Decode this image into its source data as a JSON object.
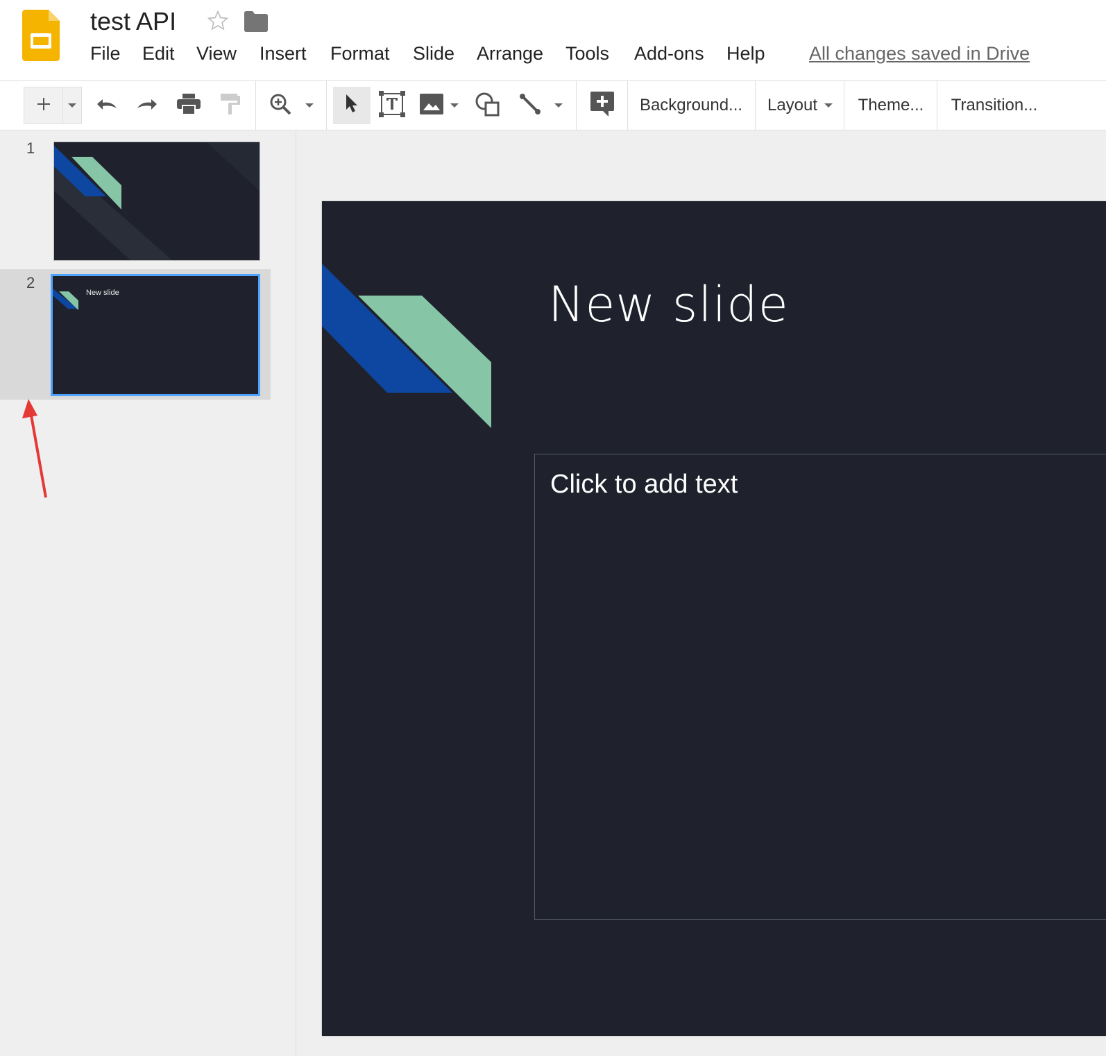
{
  "app": {
    "title": "test API",
    "save_status": "All changes saved in Drive"
  },
  "menu": [
    "File",
    "Edit",
    "View",
    "Insert",
    "Format",
    "Slide",
    "Arrange",
    "Tools",
    "Add-ons",
    "Help"
  ],
  "toolbar": {
    "background_label": "Background...",
    "layout_label": "Layout",
    "theme_label": "Theme...",
    "transition_label": "Transition..."
  },
  "filmstrip": {
    "slides": [
      {
        "number": "1"
      },
      {
        "number": "2",
        "title": "New slide"
      }
    ]
  },
  "slide": {
    "title": "New slide",
    "body_placeholder": "Click to add text"
  },
  "colors": {
    "slide_bg": "#1f222d",
    "accent_blue": "#0d47a1",
    "accent_green": "#86c5a6",
    "selection": "#1a73e8",
    "annotation_arrow": "#e53935"
  }
}
